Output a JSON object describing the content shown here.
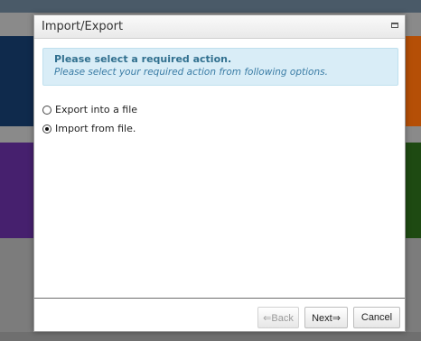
{
  "dialog": {
    "title": "Import/Export",
    "alert": {
      "title": "Please select a required action.",
      "text": "Please select your required action from following options."
    },
    "options": [
      {
        "label": "Export into a file",
        "selected": false
      },
      {
        "label": "Import from file.",
        "selected": true
      }
    ],
    "buttons": {
      "back": "⇐Back",
      "next": "Next⇒",
      "cancel": "Cancel"
    }
  }
}
